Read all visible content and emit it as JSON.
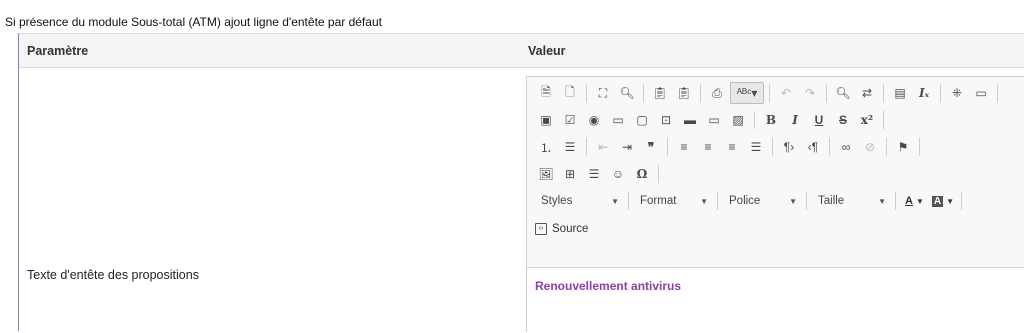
{
  "intro_text": "Si présence du module Sous-total (ATM) ajout ligne d'entête par défaut",
  "table": {
    "header_param": "Paramètre",
    "header_value": "Valeur",
    "row_label": "Texte d'entête des propositions"
  },
  "editor": {
    "combos": {
      "styles": "Styles",
      "format": "Format",
      "font": "Police",
      "size": "Taille"
    },
    "source_label": "Source",
    "content_text": "Renouvellement antivirus"
  }
}
